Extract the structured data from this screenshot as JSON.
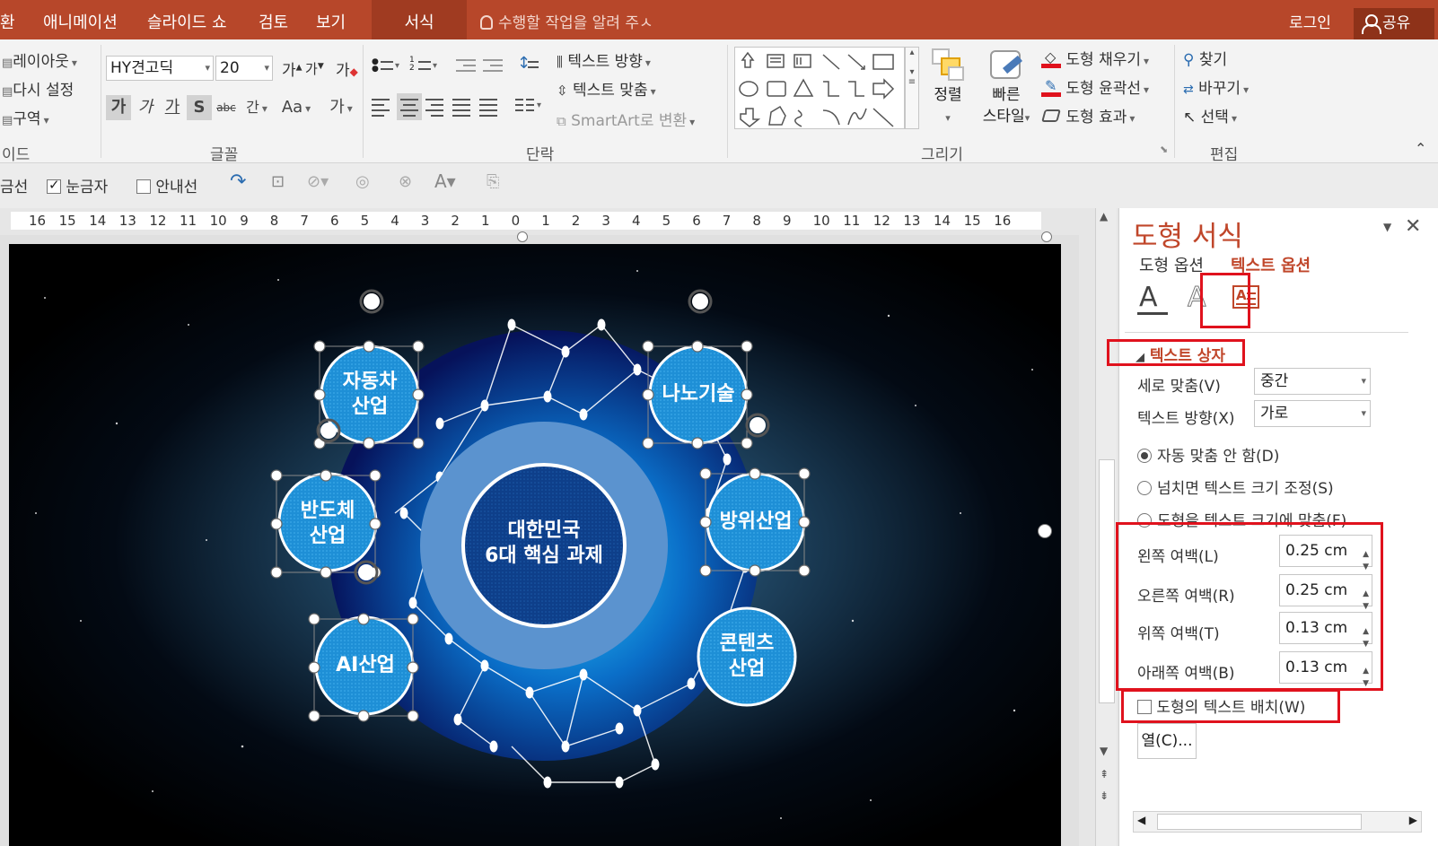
{
  "tabs": {
    "t0": "환",
    "t1": "애니메이션",
    "t2": "슬라이드 쇼",
    "t3": "검토",
    "t4": "보기",
    "t5": "서식"
  },
  "tell_me": "수행할 작업을 알려 주ㅅ",
  "login": "로그인",
  "share": "공유",
  "ribbon": {
    "slides": {
      "layout": "레이아웃",
      "reset": "다시 설정",
      "section": "구역",
      "label": "이드"
    },
    "font": {
      "name": "HY견고딕",
      "size": "20",
      "grow": "가",
      "shrink": "가",
      "clear": "가",
      "bold": "가",
      "italic": "가",
      "underline": "가",
      "shadow": "S",
      "strike": "abc",
      "spacing": "간",
      "case": "Aa",
      "color": "가",
      "label": "글꼴"
    },
    "paragraph": {
      "text_direction": "텍스트 방향",
      "align_text": "텍스트 맞춤",
      "smartart": "SmartArt로 변환",
      "label": "단락"
    },
    "drawing": {
      "arrange": "정렬",
      "quick_styles_1": "빠른",
      "quick_styles_2": "스타일",
      "fill": "도형 채우기",
      "outline": "도형 윤곽선",
      "effects": "도형 효과",
      "label": "그리기"
    },
    "editing": {
      "find": "찾기",
      "replace": "바꾸기",
      "select": "선택",
      "label": "편집"
    }
  },
  "viewbar": {
    "gridlines": "금선",
    "ruler": "눈금자",
    "guides": "안내선"
  },
  "ruler_ticks": [
    "16",
    "15",
    "14",
    "13",
    "12",
    "11",
    "10",
    "9",
    "8",
    "7",
    "6",
    "5",
    "4",
    "3",
    "2",
    "1",
    "0",
    "1",
    "2",
    "3",
    "4",
    "5",
    "6",
    "7",
    "8",
    "9",
    "10",
    "11",
    "12",
    "13",
    "14",
    "15",
    "16"
  ],
  "slide": {
    "center_line1": "대한민국",
    "center_line2": "6대 핵심 과제",
    "nodes": [
      {
        "l1": "자동차",
        "l2": "산업"
      },
      {
        "l1": "나노기술",
        "l2": ""
      },
      {
        "l1": "반도체",
        "l2": "산업"
      },
      {
        "l1": "방위산업",
        "l2": ""
      },
      {
        "l1": "AI산업",
        "l2": ""
      },
      {
        "l1": "콘텐츠",
        "l2": "산업"
      }
    ]
  },
  "pane": {
    "title": "도형 서식",
    "tab_shape": "도형 옵션",
    "tab_text": "텍스트 옵션",
    "section": "텍스트 상자",
    "valign_label": "세로 맞춤(V)",
    "valign_value": "중간",
    "dir_label": "텍스트 방향(X)",
    "dir_value": "가로",
    "radio1": "자동 맞춤 안 함(D)",
    "radio2": "넘치면 텍스트 크기 조정(S)",
    "radio3": "도형을 텍스트 크기에 맞춤(F)",
    "left_label": "왼쪽 여백(L)",
    "left_value": "0.25 cm",
    "right_label": "오른쪽 여백(R)",
    "right_value": "0.25 cm",
    "top_label": "위쪽 여백(T)",
    "top_value": "0.13 cm",
    "bottom_label": "아래쪽 여백(B)",
    "bottom_value": "0.13 cm",
    "wrap_label": "도형의 텍스트 배치(W)",
    "columns": "열(C)..."
  },
  "colors": {
    "accent": "#b7472a",
    "highlight": "#e0121d",
    "pane_title": "#c0462a"
  }
}
